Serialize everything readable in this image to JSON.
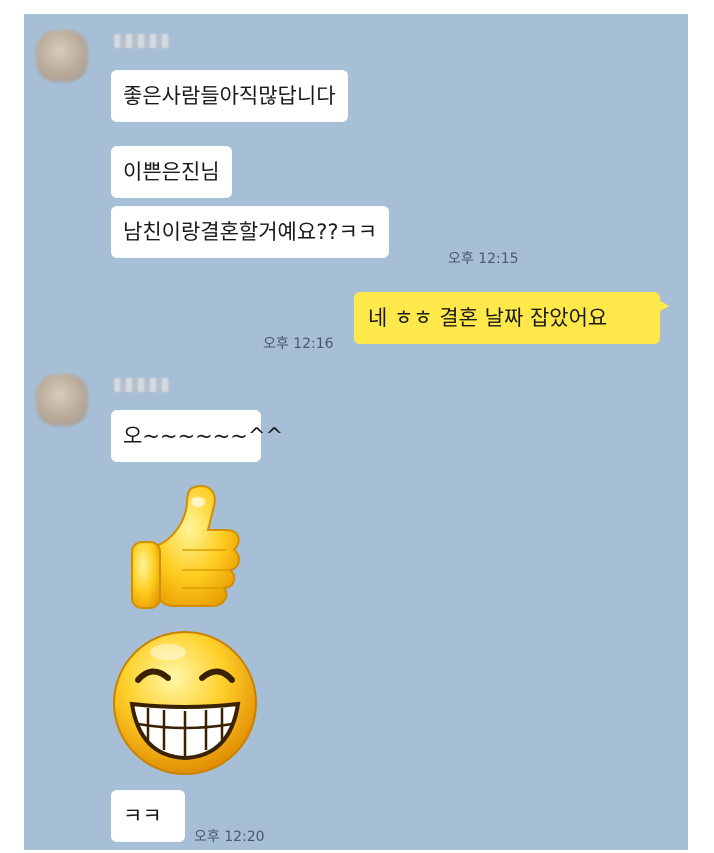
{
  "messages": [
    {
      "text": "좋은사람들아직많답니다"
    },
    {
      "text": "이쁜은진님"
    },
    {
      "text": "남친이랑결혼할거예요??ㅋㅋ",
      "time": "오후 12:15"
    },
    {
      "text": "네 ㅎㅎ 결혼 날짜 잡았어요",
      "time": "오후 12:16"
    },
    {
      "text": "오~~~~~~^^"
    },
    {
      "emoticon": "thumbs-up-icon"
    },
    {
      "emoticon": "grinning-face-icon"
    },
    {
      "text": "ㅋㅋ",
      "time": "오후 12:20"
    }
  ],
  "colors": {
    "chat_background": "#a6bfd6",
    "incoming_bubble": "#ffffff",
    "outgoing_bubble": "#ffe94a"
  }
}
